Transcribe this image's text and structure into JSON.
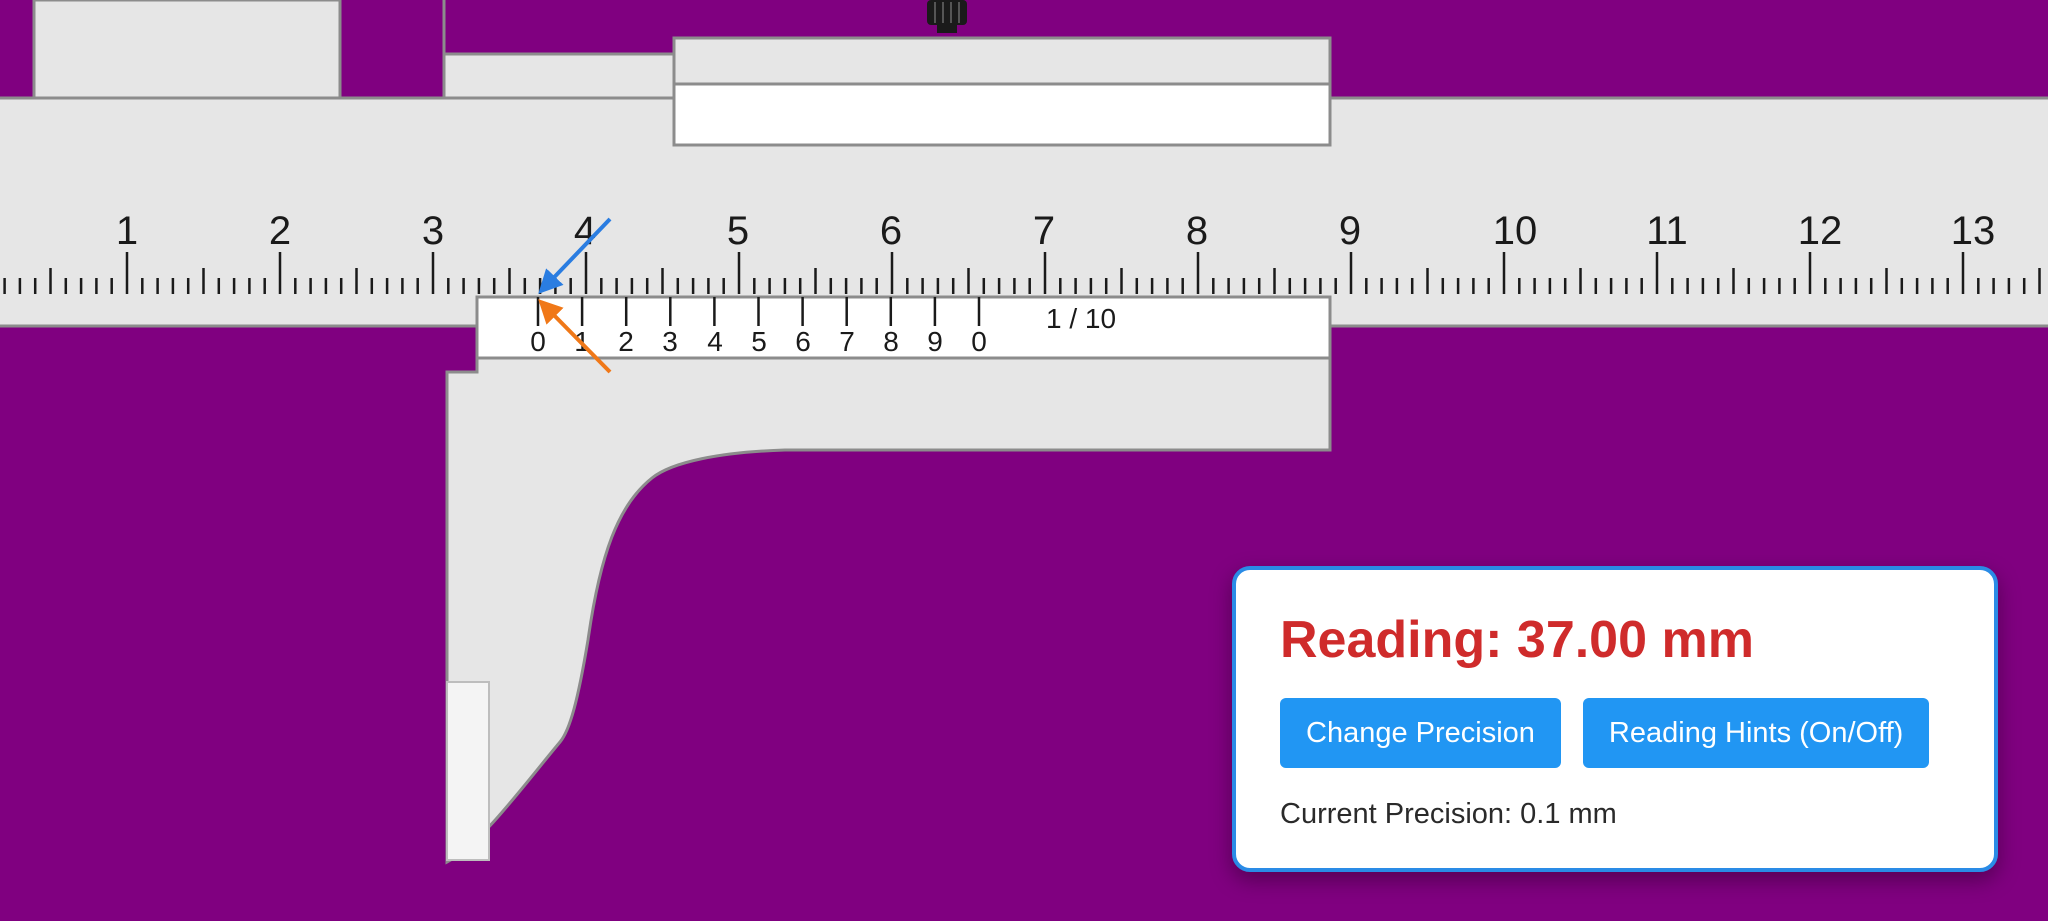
{
  "main_scale": {
    "labels": [
      "1",
      "2",
      "3",
      "4",
      "5",
      "6",
      "7",
      "8",
      "9",
      "10",
      "11",
      "12",
      "13"
    ]
  },
  "vernier": {
    "labels": [
      "0",
      "1",
      "2",
      "3",
      "4",
      "5",
      "6",
      "7",
      "8",
      "9",
      "0"
    ],
    "precision_label": "1 / 10"
  },
  "readout_panel": {
    "reading_text": "Reading: 37.00 mm",
    "change_precision_label": "Change Precision",
    "reading_hints_label": "Reading Hints (On/Off)",
    "precision_status": "Current Precision: 0.1 mm"
  },
  "colors": {
    "background": "#800080",
    "caliper_body": "#e6e6e6",
    "hint_arrow_main": "#2a7de1",
    "hint_arrow_vernier": "#f07818",
    "reading_text": "#cf2b2b",
    "button": "#2196f3",
    "panel_border": "#2a8be6"
  }
}
